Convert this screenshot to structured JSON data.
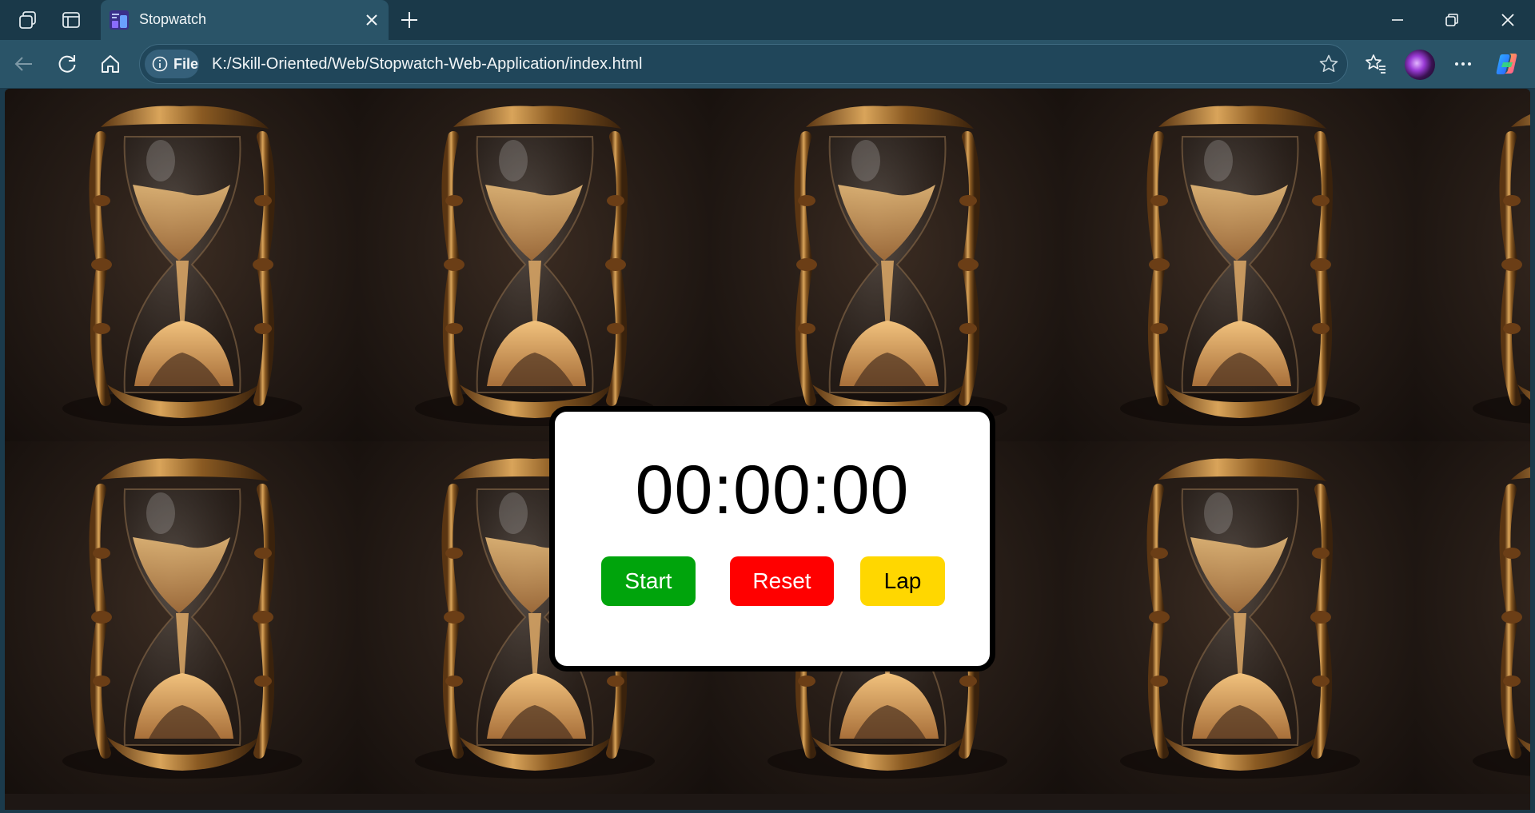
{
  "browser": {
    "tab": {
      "title": "Stopwatch"
    },
    "address": {
      "scheme_label": "File",
      "url": "K:/Skill-Oriented/Web/Stopwatch-Web-Application/index.html"
    },
    "icons": [
      "workspaces-icon",
      "tab-actions-icon",
      "close-icon",
      "new-tab-icon",
      "minimize-icon",
      "restore-icon",
      "back-icon",
      "refresh-icon",
      "home-icon",
      "info-icon",
      "favorite-star-icon",
      "favorites-icon",
      "more-icon",
      "copilot-icon"
    ]
  },
  "stopwatch": {
    "display": "00:00:00",
    "buttons": {
      "start": "Start",
      "reset": "Reset",
      "lap": "Lap"
    }
  },
  "colors": {
    "start": "#00a40c",
    "reset": "#ff0000",
    "lap": "#ffd700",
    "card_border": "#000000",
    "chrome_dark": "#1a3949",
    "chrome_light": "#2a5468"
  },
  "background": {
    "image_subject": "hourglass",
    "repeat": "tiled"
  }
}
